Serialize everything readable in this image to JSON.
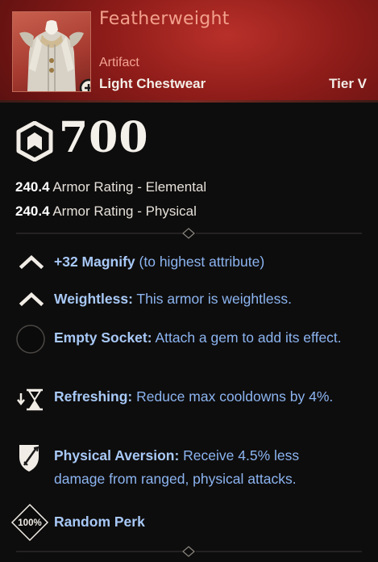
{
  "item": {
    "name": "Featherweight",
    "rarity": "Artifact",
    "type": "Light Chestwear",
    "tier": "Tier V",
    "gear_score": "700"
  },
  "armor": [
    {
      "value": "240.4",
      "label": "Armor Rating - Elemental"
    },
    {
      "value": "240.4",
      "label": "Armor Rating - Physical"
    }
  ],
  "perks": [
    {
      "name": "+32 Magnify",
      "desc": " (to highest attribute)",
      "icon": "chevron-up-icon"
    },
    {
      "name": "Weightless:",
      "desc": " This armor is weightless.",
      "icon": "chevron-up-icon"
    },
    {
      "name": "Empty Socket:",
      "desc": " Attach a gem to add its effect.",
      "icon": "empty-socket-icon"
    },
    {
      "name": "Refreshing:",
      "desc": " Reduce max cooldowns by 4%.",
      "icon": "hourglass-icon"
    },
    {
      "name": "Physical Aversion:",
      "desc": " Receive 4.5% less damage from ranged, physical attacks.",
      "icon": "shield-sword-icon"
    },
    {
      "name": "Random Perk",
      "desc": "",
      "icon": "random-perk-icon",
      "badge": "100%"
    }
  ],
  "colors": {
    "header": "#8e1c19",
    "title": "#f2a08c",
    "perk_text": "#8bb4f0"
  }
}
